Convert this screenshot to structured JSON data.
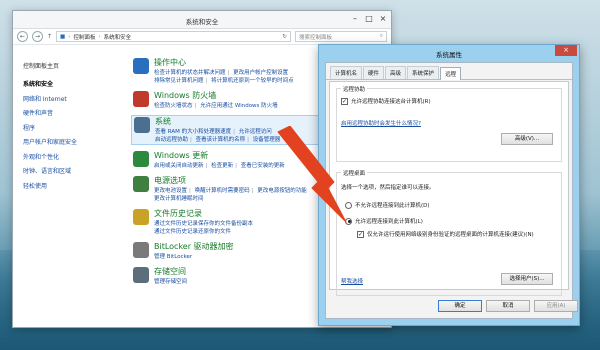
{
  "control_panel": {
    "title": "系统和安全",
    "address": {
      "breadcrumb": [
        "控制面板",
        "系统和安全"
      ]
    },
    "search_placeholder": "搜索控制面板",
    "sidebar": {
      "home": "控制面板主页",
      "items": [
        {
          "label": "系统和安全",
          "active": true
        },
        {
          "label": "网络和 Internet",
          "active": false
        },
        {
          "label": "硬件和声音",
          "active": false
        },
        {
          "label": "程序",
          "active": false
        },
        {
          "label": "用户帐户和家庭安全",
          "active": false
        },
        {
          "label": "外观和个性化",
          "active": false
        },
        {
          "label": "时钟、语言和区域",
          "active": false
        },
        {
          "label": "轻松使用",
          "active": false
        }
      ]
    },
    "categories": [
      {
        "title": "操作中心",
        "color": "#2a6fbf",
        "links": [
          "检查计算机的状态并解决问题",
          "更改用户帐户控制设置",
          "排除常见计算机问题",
          "将计算机还原到一个较早的时间点"
        ]
      },
      {
        "title": "Windows 防火墙",
        "color": "#c0392b",
        "links": [
          "检查防火墙状态",
          "允许应用通过 Windows 防火墙"
        ]
      },
      {
        "title": "系统",
        "color": "#4a6f8f",
        "links": [
          "查看 RAM 的大小和处理器速度",
          "允许远程访问",
          "启动远程协助",
          "查看该计算机的名称",
          "设备管理器"
        ],
        "selected": true
      },
      {
        "title": "Windows 更新",
        "color": "#2b8a3e",
        "links": [
          "启用或关闭自动更新",
          "检查更新",
          "查看已安装的更新"
        ]
      },
      {
        "title": "电源选项",
        "color": "#3f7f3f",
        "links": [
          "更改电池设置",
          "唤醒计算机时需要密码",
          "更改电源按钮的功能",
          "更改计算机睡眠时间"
        ]
      },
      {
        "title": "文件历史记录",
        "color": "#c9a227",
        "links": [
          "通过文件历史记录保存你的文件备份副本",
          "通过文件历史记录还原你的文件"
        ]
      },
      {
        "title": "BitLocker 驱动器加密",
        "color": "#7a7a7a",
        "links": [
          "管理 BitLocker"
        ]
      },
      {
        "title": "存储空间",
        "color": "#5c6e7a",
        "links": [
          "管理存储空间"
        ]
      }
    ]
  },
  "system_properties": {
    "title": "系统属性",
    "close_label": "×",
    "tabs": [
      "计算机名",
      "硬件",
      "高级",
      "系统保护",
      "远程"
    ],
    "active_tab": "远程",
    "remote_assistance": {
      "group_title": "远程协助",
      "checkbox_label": "允许远程协助连接这台计算机(R)",
      "checked": true,
      "link": "启用远程协助时会发生什么情况?",
      "advanced_button": "高级(V)..."
    },
    "remote_desktop": {
      "group_title": "远程桌面",
      "instruction": "选择一个选项，然后指定谁可以连接。",
      "option_deny": "不允许远程连接到此计算机(D)",
      "option_allow": "允许远程连接到此计算机(L)",
      "selected": "allow",
      "nla_checkbox": "仅允许运行使用网络级别身份验证的远程桌面的计算机连接(建议)(N)",
      "nla_checked": true,
      "help_link": "帮我选择",
      "select_users_button": "选择用户(S)..."
    },
    "footer": {
      "ok": "确定",
      "cancel": "取消",
      "apply": "应用(A)"
    }
  },
  "colors": {
    "arrow": "#e2421f",
    "dialog_frame": "#9bd0ef",
    "link": "#1a4ea0",
    "category_title": "#157a2a"
  }
}
